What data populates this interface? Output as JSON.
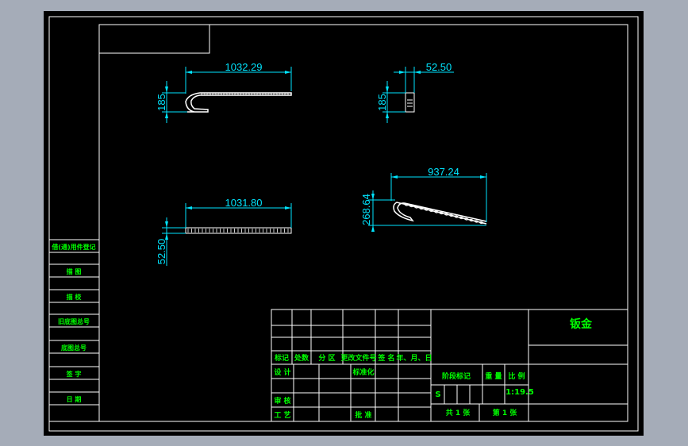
{
  "colors": {
    "background": "#a5acb8",
    "paper": "#000000",
    "frame": "#ffffff",
    "dimension": "#00e5ff",
    "label": "#00ff00"
  },
  "dimensions": {
    "view1_length": "1032.29",
    "view1_height": "185",
    "view2_width": "52.50",
    "view2_height": "185",
    "view3_length": "1031.80",
    "view3_height": "52.50",
    "view4_length": "937.24",
    "view4_height": "268.64"
  },
  "side_table": {
    "rows": [
      "借(通)用件登记",
      "描 图",
      "描 校",
      "旧底图总号",
      "底图总号",
      "签 字",
      "日 期"
    ]
  },
  "title_block": {
    "part_name": "钣金",
    "revision_headers": [
      "标记",
      "处数",
      "分 区",
      "更改文件号",
      "签 名",
      "年、月、日"
    ],
    "design_label": "设 计",
    "standardization_label": "标准化",
    "review_label": "审 核",
    "process_label": "工 艺",
    "approve_label": "批 准",
    "stage_label": "阶段标记",
    "weight_label": "重 量",
    "scale_label": "比 例",
    "stage_value": "S",
    "scale_value": "1:19.5",
    "sheet_total": "共 1 张",
    "sheet_number": "第 1 张"
  }
}
